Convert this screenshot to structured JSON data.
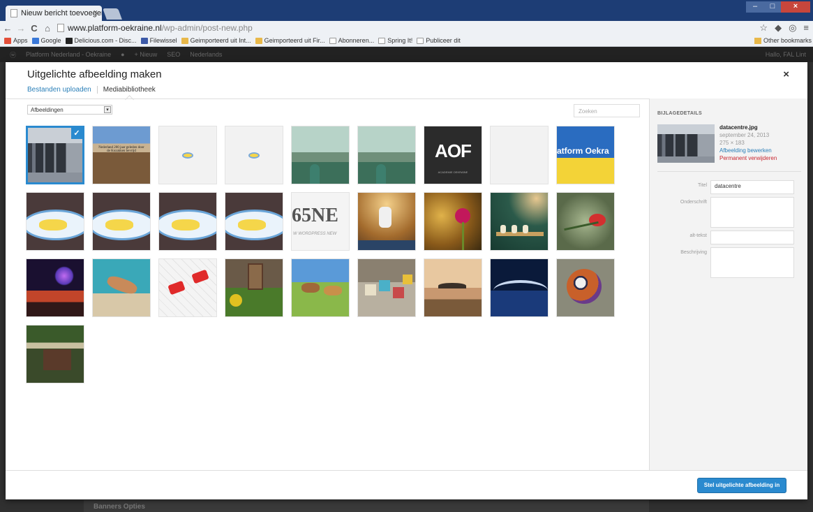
{
  "browser": {
    "tab_title": "Nieuw bericht toevoegen",
    "tab_close": "×",
    "url_host": "www.platform-oekraine.nl",
    "url_path": "/wp-admin/post-new.php",
    "bookmarks": [
      {
        "label": "Apps",
        "color": "#e34f3a"
      },
      {
        "label": "Google",
        "color": "#3a78d8"
      },
      {
        "label": "Delicious.com - Disc...",
        "color": "#222222"
      },
      {
        "label": "Filewissel",
        "color": "#3d5aa8"
      },
      {
        "label": "Geimporteerd uit Int...",
        "color": "#e8b84a"
      },
      {
        "label": "Geimporteerd uit Fir...",
        "color": "#e8b84a"
      },
      {
        "label": "Abonneren...",
        "color": "#ffffff"
      },
      {
        "label": "Spring It!",
        "color": "#ffffff"
      },
      {
        "label": "Publiceer dit",
        "color": "#ffffff"
      }
    ],
    "other_bookmarks": "Other bookmarks"
  },
  "adminbar": {
    "site": "Platform Nederland - Oekraine",
    "new": "+ Nieuw",
    "seo": "SEO",
    "lang": "Nederlands",
    "howdy": "Hallo, FAL Lint"
  },
  "background": {
    "metabox_title": "Banners Opties"
  },
  "modal": {
    "title": "Uitgelichte afbeelding maken",
    "close": "×",
    "tab_upload": "Bestanden uploaden",
    "tab_library": "Mediabibliotheek",
    "filter_value": "Afbeeldingen",
    "search_placeholder": "Zoeken",
    "insert_button": "Stel uitgelichte afbeelding in",
    "thumb_text": {
      "nl200": "Nederland 200 jaar geleden door de Kozakken bevrijd",
      "aof": "AOF",
      "aof_sub": "ACADEMIE OEKRAÏNE",
      "platform": "atform Oekra",
      "ne": "65NE",
      "ne_sub": "W WORDPRESS NEW"
    }
  },
  "sidebar": {
    "heading": "BIJLAGEDETAILS",
    "filename": "datacentre.jpg",
    "date": "september 24, 2013",
    "dims": "275 × 183",
    "edit_link": "Afbeelding bewerken",
    "delete_link": "Permanent verwijderen",
    "fields": [
      {
        "label": "Titel",
        "value": "datacentre"
      },
      {
        "label": "Onderschrift",
        "value": ""
      },
      {
        "label": "alt-tekst",
        "value": ""
      },
      {
        "label": "Beschrijving",
        "value": ""
      }
    ]
  },
  "colors": {
    "accent": "#2a8acf",
    "link": "#2a7fb8",
    "danger": "#c8262f"
  }
}
